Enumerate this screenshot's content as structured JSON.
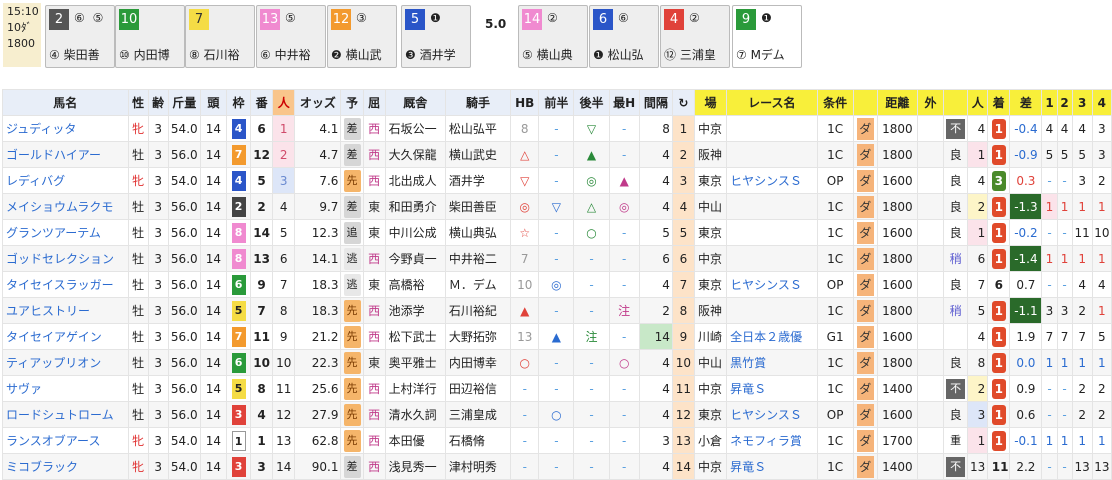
{
  "race": {
    "time": "15:10",
    "race_no": "10ﾀﾞ",
    "distance": "1800"
  },
  "odds_label": "5.0",
  "lineup": [
    {
      "num": "2",
      "marks": "⑥ ⑤",
      "jockey": "④ 柴田善",
      "bg": "#555",
      "fg": "#fff"
    },
    {
      "num": "10",
      "marks": "",
      "jockey": "⑩ 内田博",
      "bg": "#2a9a3a",
      "fg": "#fff"
    },
    {
      "num": "7",
      "marks": "",
      "jockey": "⑧ 石川裕",
      "bg": "#f5dc45",
      "fg": "#333"
    },
    {
      "num": "13",
      "marks": "⑤",
      "jockey": "⑥ 中井裕",
      "bg": "#f08ad0",
      "fg": "#fff"
    },
    {
      "num": "12",
      "marks": "③",
      "jockey": "❷ 横山武",
      "bg": "#f39a2e",
      "fg": "#fff"
    },
    {
      "num": "5",
      "marks": "❶",
      "jockey": "❸ 酒井学",
      "bg": "#2a55c8",
      "fg": "#fff"
    },
    {
      "num": "14",
      "marks": "②",
      "jockey": "⑤ 横山典",
      "bg": "#f08ad0",
      "fg": "#fff"
    },
    {
      "num": "6",
      "marks": "⑥",
      "jockey": "❶ 松山弘",
      "bg": "#2a55c8",
      "fg": "#fff"
    },
    {
      "num": "4",
      "marks": "②",
      "jockey": "⑫ 三浦皇",
      "bg": "#e0423a",
      "fg": "#fff"
    },
    {
      "num": "9",
      "marks": "❶",
      "jockey": "⑦ Mデム",
      "bg": "#2a9a3a",
      "fg": "#fff"
    }
  ],
  "headers": [
    "馬名",
    "性",
    "齢",
    "斤量",
    "頭",
    "枠",
    "番",
    "人",
    "オッズ",
    "予",
    "屈",
    "厩舎",
    "騎手",
    "HB",
    "前半",
    "後半",
    "最H",
    "間隔",
    "↻",
    "場",
    "レース名",
    "条件",
    "",
    "距離",
    "外",
    "",
    "人",
    "着",
    "差",
    "1",
    "2",
    "3",
    "4"
  ],
  "horses": [
    {
      "name": "ジュディッタ",
      "sex": "牝",
      "age": "3",
      "wt": "54.0",
      "heads": "14",
      "waku": "4",
      "ban": "6",
      "ninki": "1",
      "odds": "4.1",
      "yoso": "差",
      "ku": "西",
      "trainer": "石坂公一",
      "jockey": "松山弘平",
      "hb": "8",
      "zen": "-",
      "kou": "▽",
      "maxh": "-",
      "kan": "8",
      "rot": "1",
      "place": "中京",
      "rname": "",
      "cond": "1C",
      "dist": "1800",
      "soto": "",
      "baba": "不",
      "pn": "4",
      "chaku": "1",
      "sa": "-0.4",
      "c1": "4",
      "c2": "4",
      "c3": "4",
      "c4": "3"
    },
    {
      "name": "ゴールドハイアー",
      "sex": "牡",
      "age": "3",
      "wt": "56.0",
      "heads": "14",
      "waku": "7",
      "ban": "12",
      "ninki": "2",
      "odds": "4.7",
      "yoso": "差",
      "ku": "西",
      "trainer": "大久保龍",
      "jockey": "横山武史",
      "hb": "△",
      "zen": "-",
      "kou": "▲",
      "maxh": "-",
      "kan": "4",
      "rot": "2",
      "place": "阪神",
      "rname": "",
      "cond": "1C",
      "dist": "1800",
      "soto": "",
      "baba": "良",
      "pn": "1",
      "chaku": "1",
      "sa": "-0.9",
      "c1": "5",
      "c2": "5",
      "c3": "5",
      "c4": "3"
    },
    {
      "name": "レディバグ",
      "sex": "牝",
      "age": "3",
      "wt": "54.0",
      "heads": "14",
      "waku": "4",
      "ban": "5",
      "ninki": "3",
      "odds": "7.6",
      "yoso": "先",
      "ku": "西",
      "trainer": "北出成人",
      "jockey": "酒井学",
      "hb": "▽",
      "zen": "-",
      "kou": "◎",
      "maxh": "▲",
      "kan": "4",
      "rot": "3",
      "place": "東京",
      "rname": "ヒヤシンスＳ",
      "cond": "OP",
      "dist": "1600",
      "soto": "",
      "baba": "良",
      "pn": "4",
      "chaku": "3",
      "sa": "0.3",
      "c1": "-",
      "c2": "-",
      "c3": "3",
      "c4": "2"
    },
    {
      "name": "メイショウムラクモ",
      "sex": "牡",
      "age": "3",
      "wt": "56.0",
      "heads": "14",
      "waku": "2",
      "ban": "2",
      "ninki": "4",
      "odds": "9.7",
      "yoso": "差",
      "ku": "東",
      "trainer": "和田勇介",
      "jockey": "柴田善臣",
      "hb": "◎",
      "zen": "▽",
      "kou": "△",
      "maxh": "◎",
      "kan": "4",
      "rot": "4",
      "place": "中山",
      "rname": "",
      "cond": "1C",
      "dist": "1800",
      "soto": "",
      "baba": "良",
      "pn": "2",
      "chaku": "1",
      "sa": "-1.3",
      "c1": "1",
      "c2": "1",
      "c3": "1",
      "c4": "1"
    },
    {
      "name": "グランツアーテム",
      "sex": "牡",
      "age": "3",
      "wt": "56.0",
      "heads": "14",
      "waku": "8",
      "ban": "14",
      "ninki": "5",
      "odds": "12.3",
      "yoso": "追",
      "ku": "東",
      "trainer": "中川公成",
      "jockey": "横山典弘",
      "hb": "☆",
      "zen": "-",
      "kou": "○",
      "maxh": "-",
      "kan": "5",
      "rot": "5",
      "place": "東京",
      "rname": "",
      "cond": "1C",
      "dist": "1600",
      "soto": "",
      "baba": "良",
      "pn": "1",
      "chaku": "1",
      "sa": "-0.2",
      "c1": "-",
      "c2": "-",
      "c3": "11",
      "c4": "10"
    },
    {
      "name": "ゴッドセレクション",
      "sex": "牡",
      "age": "3",
      "wt": "56.0",
      "heads": "14",
      "waku": "8",
      "ban": "13",
      "ninki": "6",
      "odds": "14.1",
      "yoso": "逃",
      "ku": "西",
      "trainer": "今野貞一",
      "jockey": "中井裕二",
      "hb": "7",
      "zen": "-",
      "kou": "-",
      "maxh": "-",
      "kan": "6",
      "rot": "6",
      "place": "中京",
      "rname": "",
      "cond": "1C",
      "dist": "1800",
      "soto": "",
      "baba": "稍",
      "pn": "6",
      "chaku": "1",
      "sa": "-1.4",
      "c1": "1",
      "c2": "1",
      "c3": "1",
      "c4": "1"
    },
    {
      "name": "タイセイスラッガー",
      "sex": "牡",
      "age": "3",
      "wt": "56.0",
      "heads": "14",
      "waku": "6",
      "ban": "9",
      "ninki": "7",
      "odds": "18.3",
      "yoso": "逃",
      "ku": "東",
      "trainer": "高橋裕",
      "jockey": "Ｍ．デム",
      "hb": "10",
      "zen": "◎",
      "kou": "-",
      "maxh": "-",
      "kan": "4",
      "rot": "7",
      "place": "東京",
      "rname": "ヒヤシンスＳ",
      "cond": "OP",
      "dist": "1600",
      "soto": "",
      "baba": "良",
      "pn": "7",
      "chaku": "6",
      "sa": "0.7",
      "c1": "-",
      "c2": "-",
      "c3": "4",
      "c4": "4"
    },
    {
      "name": "ユアヒストリー",
      "sex": "牡",
      "age": "3",
      "wt": "56.0",
      "heads": "14",
      "waku": "5",
      "ban": "7",
      "ninki": "8",
      "odds": "18.3",
      "yoso": "先",
      "ku": "西",
      "trainer": "池添学",
      "jockey": "石川裕紀",
      "hb": "▲",
      "zen": "-",
      "kou": "-",
      "maxh": "注",
      "kan": "2",
      "rot": "8",
      "place": "阪神",
      "rname": "",
      "cond": "1C",
      "dist": "1800",
      "soto": "",
      "baba": "稍",
      "pn": "5",
      "chaku": "1",
      "sa": "-1.1",
      "c1": "3",
      "c2": "3",
      "c3": "2",
      "c4": "1"
    },
    {
      "name": "タイセイアゲイン",
      "sex": "牡",
      "age": "3",
      "wt": "56.0",
      "heads": "14",
      "waku": "7",
      "ban": "11",
      "ninki": "9",
      "odds": "21.2",
      "yoso": "先",
      "ku": "西",
      "trainer": "松下武士",
      "jockey": "大野拓弥",
      "hb": "13",
      "zen": "▲",
      "kou": "注",
      "maxh": "-",
      "kan": "14",
      "rot": "9",
      "place": "川崎",
      "rname": "全日本２歳優",
      "cond": "G1",
      "dist": "1600",
      "soto": "",
      "baba": "",
      "pn": "4",
      "chaku": "1",
      "sa": "1.9",
      "c1": "7",
      "c2": "7",
      "c3": "7",
      "c4": "5"
    },
    {
      "name": "ティアップリオン",
      "sex": "牡",
      "age": "3",
      "wt": "56.0",
      "heads": "14",
      "waku": "6",
      "ban": "10",
      "ninki": "10",
      "odds": "22.3",
      "yoso": "先",
      "ku": "東",
      "trainer": "奥平雅士",
      "jockey": "内田博幸",
      "hb": "○",
      "zen": "-",
      "kou": "-",
      "maxh": "○",
      "kan": "4",
      "rot": "10",
      "place": "中山",
      "rname": "黒竹賞",
      "cond": "1C",
      "dist": "1800",
      "soto": "",
      "baba": "良",
      "pn": "8",
      "chaku": "1",
      "sa": "0.0",
      "c1": "1",
      "c2": "1",
      "c3": "1",
      "c4": "1"
    },
    {
      "name": "サヴァ",
      "sex": "牡",
      "age": "3",
      "wt": "56.0",
      "heads": "14",
      "waku": "5",
      "ban": "8",
      "ninki": "11",
      "odds": "25.6",
      "yoso": "先",
      "ku": "西",
      "trainer": "上村洋行",
      "jockey": "田辺裕信",
      "hb": "-",
      "zen": "-",
      "kou": "-",
      "maxh": "-",
      "kan": "4",
      "rot": "11",
      "place": "中京",
      "rname": "昇竜Ｓ",
      "cond": "1C",
      "dist": "1400",
      "soto": "",
      "baba": "不",
      "pn": "2",
      "chaku": "1",
      "sa": "0.9",
      "c1": "-",
      "c2": "-",
      "c3": "2",
      "c4": "2"
    },
    {
      "name": "ロードシュトローム",
      "sex": "牡",
      "age": "3",
      "wt": "56.0",
      "heads": "14",
      "waku": "3",
      "ban": "4",
      "ninki": "12",
      "odds": "27.9",
      "yoso": "先",
      "ku": "西",
      "trainer": "清水久詞",
      "jockey": "三浦皇成",
      "hb": "-",
      "zen": "○",
      "kou": "-",
      "maxh": "-",
      "kan": "4",
      "rot": "12",
      "place": "東京",
      "rname": "ヒヤシンスＳ",
      "cond": "OP",
      "dist": "1600",
      "soto": "",
      "baba": "良",
      "pn": "3",
      "chaku": "1",
      "sa": "0.6",
      "c1": "-",
      "c2": "-",
      "c3": "2",
      "c4": "2"
    },
    {
      "name": "ランスオブアース",
      "sex": "牝",
      "age": "3",
      "wt": "54.0",
      "heads": "14",
      "waku": "1",
      "ban": "1",
      "ninki": "13",
      "odds": "62.8",
      "yoso": "先",
      "ku": "西",
      "trainer": "本田優",
      "jockey": "石橋脩",
      "hb": "-",
      "zen": "-",
      "kou": "-",
      "maxh": "-",
      "kan": "3",
      "rot": "13",
      "place": "小倉",
      "rname": "ネモフィラ賞",
      "cond": "1C",
      "dist": "1700",
      "soto": "",
      "baba": "重",
      "pn": "1",
      "chaku": "1",
      "sa": "-0.1",
      "c1": "1",
      "c2": "1",
      "c3": "1",
      "c4": "1"
    },
    {
      "name": "ミコブラック",
      "sex": "牝",
      "age": "3",
      "wt": "54.0",
      "heads": "14",
      "waku": "3",
      "ban": "3",
      "ninki": "14",
      "odds": "90.1",
      "yoso": "差",
      "ku": "西",
      "trainer": "浅見秀一",
      "jockey": "津村明秀",
      "hb": "-",
      "zen": "-",
      "kou": "-",
      "maxh": "-",
      "kan": "4",
      "rot": "14",
      "place": "中京",
      "rname": "昇竜Ｓ",
      "cond": "1C",
      "dist": "1400",
      "soto": "",
      "baba": "不",
      "pn": "13",
      "chaku": "11",
      "sa": "2.2",
      "c1": "-",
      "c2": "-",
      "c3": "13",
      "c4": "13"
    }
  ],
  "dirt_label": "ダ",
  "colors": {
    "waku1": "#ffffff",
    "waku2": "#444444",
    "waku3": "#e0423a",
    "waku4": "#2a55c8",
    "waku5": "#f5dc45",
    "waku6": "#2a9a3a",
    "waku7": "#f39a2e",
    "waku8": "#f08ad0",
    "first": "#e04a2a",
    "yellow": "#f8ef3a"
  }
}
